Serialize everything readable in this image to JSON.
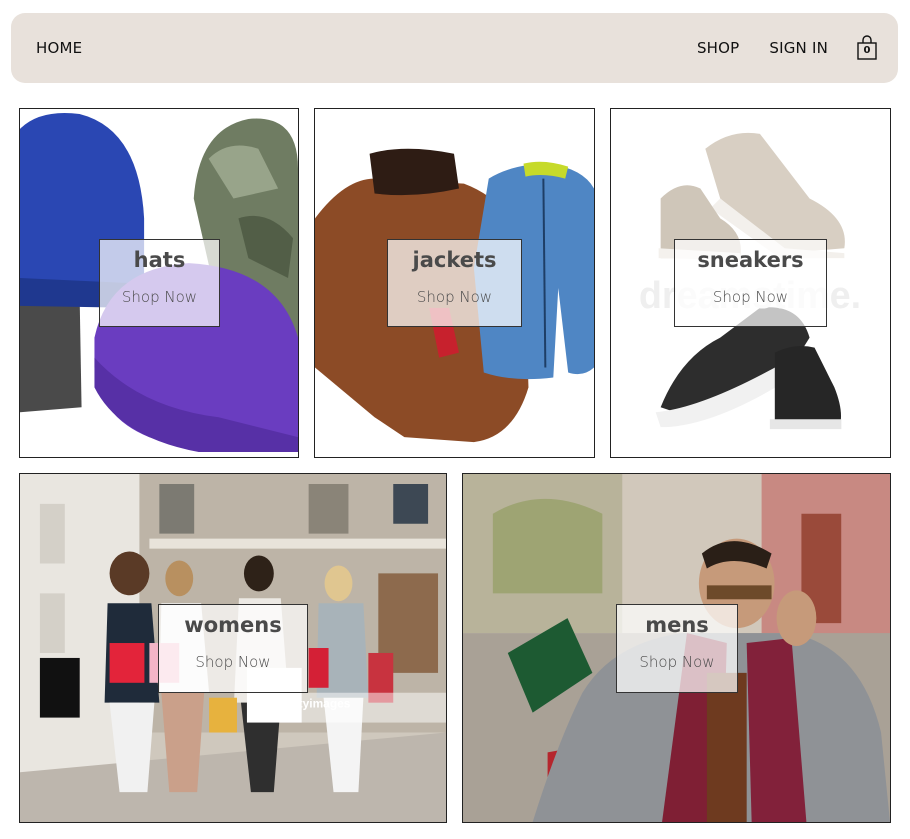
{
  "nav": {
    "home": "HOME",
    "shop": "SHOP",
    "sign_in": "SIGN IN",
    "cart_count": "0",
    "cart_icon": "shopping-bag-icon"
  },
  "categories": [
    {
      "title": "hats",
      "cta": "Shop Now"
    },
    {
      "title": "jackets",
      "cta": "Shop Now"
    },
    {
      "title": "sneakers",
      "cta": "Shop Now"
    },
    {
      "title": "womens",
      "cta": "Shop Now"
    },
    {
      "title": "mens",
      "cta": "Shop Now"
    }
  ],
  "colors": {
    "nav_bg": "#e8e1db",
    "overlay_text": "#4a4a4a"
  }
}
